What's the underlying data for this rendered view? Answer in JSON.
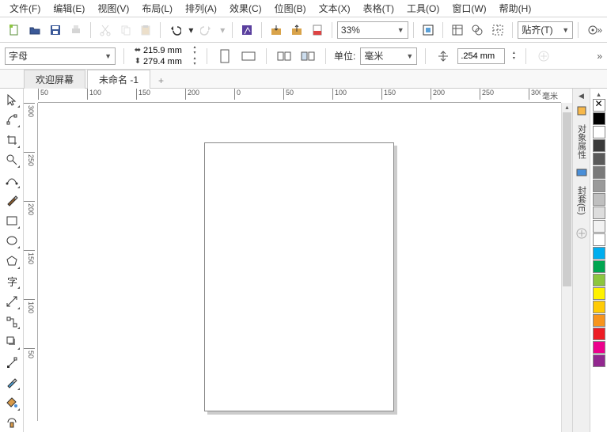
{
  "menubar": [
    {
      "label": "文件(F)"
    },
    {
      "label": "编辑(E)"
    },
    {
      "label": "视图(V)"
    },
    {
      "label": "布局(L)"
    },
    {
      "label": "排列(A)"
    },
    {
      "label": "效果(C)"
    },
    {
      "label": "位图(B)"
    },
    {
      "label": "文本(X)"
    },
    {
      "label": "表格(T)"
    },
    {
      "label": "工具(O)"
    },
    {
      "label": "窗口(W)"
    },
    {
      "label": "帮助(H)"
    }
  ],
  "toolbar1": {
    "zoom": "33%",
    "snap_label": "贴齐(T)"
  },
  "propbar": {
    "page_preset": "字母",
    "width": "215.9 mm",
    "height": "279.4 mm",
    "units_label": "单位:",
    "units_value": "毫米",
    "nudge": ".254 mm"
  },
  "tabs": {
    "welcome": "欢迎屏幕",
    "doc": "未命名 -1"
  },
  "ruler": {
    "unit": "毫米",
    "h": [
      "50",
      "100",
      "150",
      "200",
      "0",
      "50",
      "100",
      "150",
      "200",
      "250",
      "300"
    ],
    "v": [
      "300",
      "250",
      "200",
      "150",
      "100",
      "50"
    ]
  },
  "docker": {
    "l1": "对象属性",
    "l2": "封套(E)"
  },
  "palette": [
    "none",
    "#000000",
    "#FFFFFF",
    "#3a3a3a",
    "#5a5a5a",
    "#7a7a7a",
    "#9a9a9a",
    "#bfbfbf",
    "#dddddd",
    "#f2f2f2",
    "#ffffff",
    "#00aeef",
    "#00a651",
    "#8dc63f",
    "#fff200",
    "#ffcb05",
    "#f7941e",
    "#ed1c24",
    "#ec008c",
    "#92278f"
  ]
}
